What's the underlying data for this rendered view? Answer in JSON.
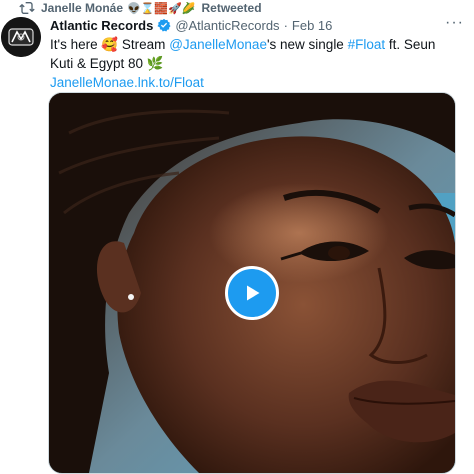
{
  "retweet": {
    "retweeter_name": "Janelle Monáe",
    "retweeter_emoji": "👽⌛🧱🚀🌽",
    "label": "Retweeted"
  },
  "tweet": {
    "author_name": "Atlantic Records",
    "handle": "@AtlanticRecords",
    "separator": "·",
    "date": "Feb 16",
    "more_label": "···",
    "text_intro": "It's here 🥰 Stream ",
    "mention": "@JanelleMonae",
    "text_mid": "'s new single ",
    "hashtag": "#Float",
    "text_tail": " ft. Seun Kuti & Egypt 80 🌿",
    "link": "JanelleMonae.lnk.to/Float"
  },
  "colors": {
    "link_blue": "#1d9bf0",
    "secondary_text": "#536471",
    "retweet_green": "#536471"
  },
  "icons": {
    "retweet": "retweet-icon",
    "verified": "verified-badge-icon",
    "play": "play-icon",
    "more": "more-options-icon"
  }
}
